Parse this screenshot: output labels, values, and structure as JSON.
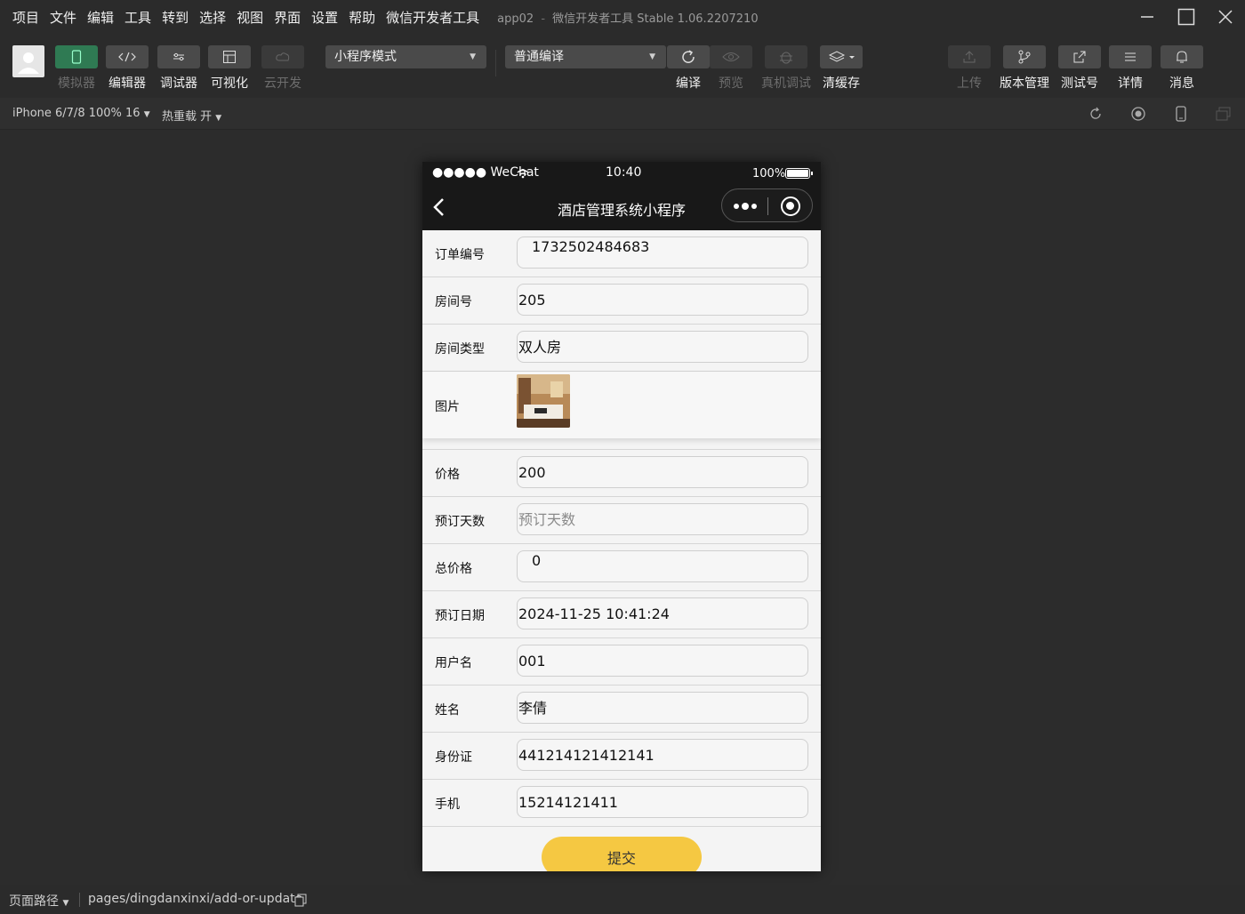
{
  "menubar": {
    "items": [
      "项目",
      "文件",
      "编辑",
      "工具",
      "转到",
      "选择",
      "视图",
      "界面",
      "设置",
      "帮助",
      "微信开发者工具"
    ],
    "project": "app02",
    "separator": "-",
    "app_title": "微信开发者工具 Stable 1.06.2207210"
  },
  "toolbar": {
    "simulator_label": "模拟器",
    "editor_label": "编辑器",
    "debugger_label": "调试器",
    "visual_label": "可视化",
    "cloud_label": "云开发",
    "mode_select": "小程序模式",
    "compile_select": "普通编译",
    "compile_label": "编译",
    "preview_label": "预览",
    "remote_debug_label": "真机调试",
    "clear_cache_label": "清缓存",
    "upload_label": "上传",
    "version_label": "版本管理",
    "test_label": "测试号",
    "details_label": "详情",
    "messages_label": "消息"
  },
  "subbar": {
    "device": "iPhone 6/7/8 100% 16",
    "hot_reload": "热重载 开"
  },
  "phone": {
    "signal": "●●●●● WeChat",
    "time": "10:40",
    "battery": "100%",
    "nav_title": "酒店管理系统小程序",
    "form": {
      "order_no_label": "订单编号",
      "order_no": "1732502484683",
      "room_no_label": "房间号",
      "room_no": "205",
      "room_type_label": "房间类型",
      "room_type": "双人房",
      "image_label": "图片",
      "price_label": "价格",
      "price": "200",
      "days_label": "预订天数",
      "days_placeholder": "预订天数",
      "total_label": "总价格",
      "total": "0",
      "date_label": "预订日期",
      "date": "2024-11-25 10:41:24",
      "username_label": "用户名",
      "username": "001",
      "name_label": "姓名",
      "name": "李倩",
      "id_label": "身份证",
      "id_no": "441214121412141",
      "phone_label": "手机",
      "phone_no": "15214121411",
      "submit": "提交"
    }
  },
  "bottombar": {
    "path_label": "页面路径",
    "path": "pages/dingdanxinxi/add-or-update"
  },
  "colors": {
    "accent_green": "#2f7a53",
    "submit_yellow": "#f5c842",
    "dark_bg": "#2c2c2c",
    "nav_bg": "#181818"
  }
}
